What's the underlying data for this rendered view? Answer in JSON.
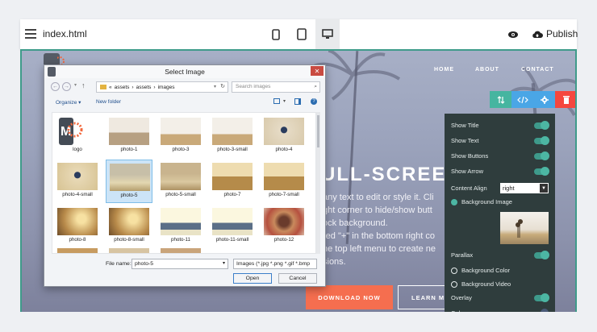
{
  "toolbar": {
    "filename": "index.html",
    "publish_label": "Publish"
  },
  "site": {
    "nav": [
      "HOME",
      "ABOUT",
      "CONTACT"
    ],
    "hero_title": "ULL-SCREEN",
    "hero_lines": [
      "any text to edit or style it. Cli",
      "ght corner to hide/show butt",
      "ock background.",
      "red \"+\" in the bottom right co",
      "he top left menu to create ne",
      "sions."
    ],
    "download_label": "DOWNLOAD NOW",
    "learn_label": "LEARN M"
  },
  "block_tools": {
    "icons": [
      "arrows-icon",
      "code-icon",
      "gear-icon",
      "trash-icon"
    ],
    "colors": [
      "#46b5a0",
      "#4aa6e6",
      "#4aa6e6",
      "#f5473e"
    ]
  },
  "panel": {
    "show_title": "Show Title",
    "show_text": "Show Text",
    "show_buttons": "Show Buttons",
    "show_arrow": "Show Arrow",
    "content_align_label": "Content Align",
    "content_align_value": "right",
    "background_image": "Background Image",
    "parallax": "Parallax",
    "background_color": "Background Color",
    "background_video": "Background Video",
    "overlay": "Overlay",
    "color": "Color"
  },
  "dialog": {
    "title": "Select Image",
    "path": [
      "«",
      "assets",
      "›",
      "assets",
      "›",
      "images"
    ],
    "search_placeholder": "Search images",
    "organize": "Organize ▾",
    "new_folder": "New folder",
    "files": [
      "logo",
      "photo-1",
      "photo-3",
      "photo-3-small",
      "photo-4",
      "photo-4-small",
      "photo-5",
      "photo-5-small",
      "photo-7",
      "photo-7-small",
      "photo-8",
      "photo-8-small",
      "photo-11",
      "photo-11-small",
      "photo-12"
    ],
    "selected_file": "photo-5",
    "file_name_label": "File name:",
    "file_name_value": "photo-5",
    "file_type_value": "Images (*.jpg *.png *.gif *.bmp",
    "open_label": "Open",
    "cancel_label": "Cancel"
  }
}
